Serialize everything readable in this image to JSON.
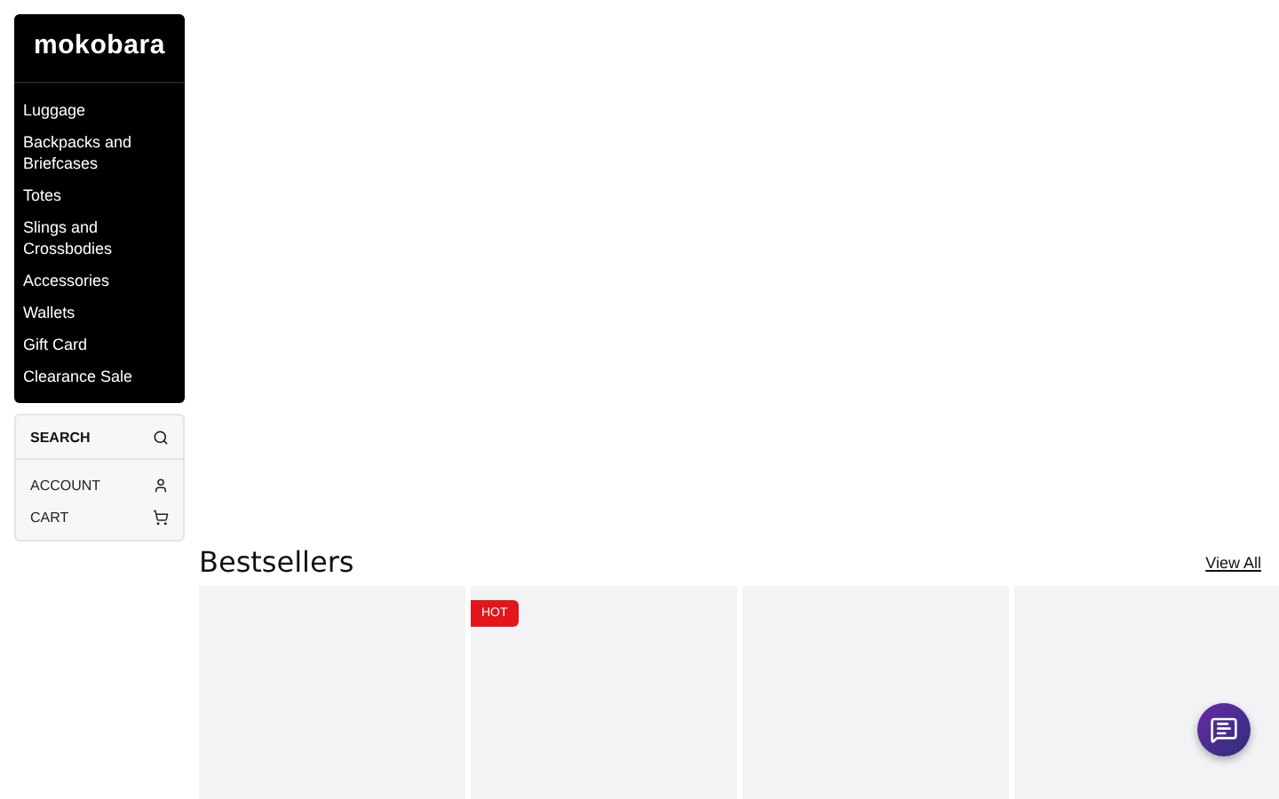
{
  "logo": "mokobara",
  "menu": [
    "Luggage",
    "Backpacks and Briefcases",
    "Totes",
    "Slings and Crossbodies",
    "Accessories",
    "Wallets",
    "Gift Card",
    "Clearance Sale"
  ],
  "search": {
    "label": "SEARCH"
  },
  "links": [
    {
      "kind": "account",
      "label": "ACCOUNT"
    },
    {
      "kind": "cart",
      "label": "CART"
    }
  ],
  "bestsellers": {
    "title": "Bestsellers",
    "view_all": "View All",
    "products": [
      {
        "hot": false
      },
      {
        "hot": true,
        "badge": "HOT"
      },
      {
        "hot": false
      },
      {
        "hot": false
      }
    ]
  }
}
